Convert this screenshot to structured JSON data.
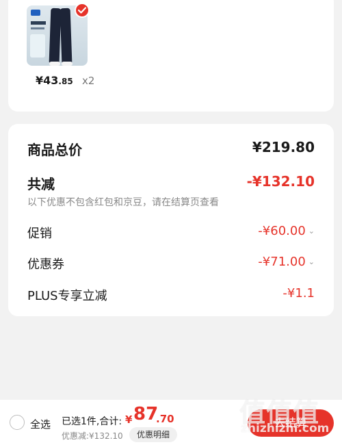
{
  "product": {
    "price_symbol": "¥",
    "price_int": "43",
    "price_dec": ".85",
    "quantity": "x2"
  },
  "summary": {
    "total_label": "商品总价",
    "total_value": "¥219.80",
    "reduce_label": "共减",
    "reduce_value": "-¥132.10",
    "reduce_note": "以下优惠不包含红包和京豆，请在结算页查看",
    "promo_label": "促销",
    "promo_value": "-¥60.00",
    "coupon_label": "优惠券",
    "coupon_value": "-¥71.00",
    "plus_label": "PLUS专享立减",
    "plus_value": "-¥1.1"
  },
  "bottom_bar": {
    "select_all": "全选",
    "picked": "已选1件,合计:",
    "total_symbol": "¥",
    "total_int": "87",
    "total_dec": ".70",
    "discount": "优惠减:¥132.10",
    "detail_button": "优惠明细",
    "checkout_button": "去结算"
  },
  "watermark": {
    "big": "值值值",
    "small": "zhizhizhi.com"
  },
  "colors": {
    "accent": "#e6332a",
    "background": "#f2f2f2"
  }
}
